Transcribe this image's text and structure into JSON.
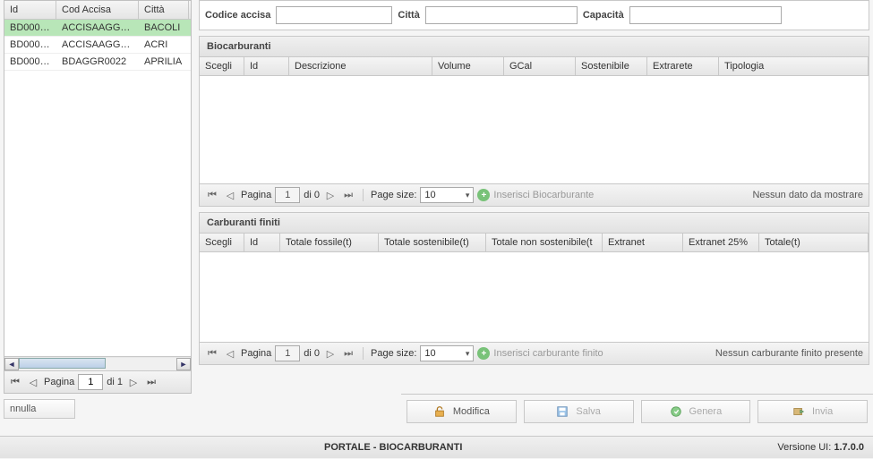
{
  "leftGrid": {
    "headers": {
      "id": "Id",
      "cod": "Cod Accisa",
      "citta": "Città"
    },
    "rows": [
      {
        "id": "BD0001...",
        "cod": "ACCISAAGGR...",
        "citta": "BACOLI"
      },
      {
        "id": "BD0001...",
        "cod": "ACCISAAGGR...",
        "citta": "ACRI"
      },
      {
        "id": "BD0001...",
        "cod": "BDAGGR0022",
        "citta": "APRILIA"
      }
    ],
    "pager": {
      "label": "Pagina",
      "page": "1",
      "of": "di 1"
    }
  },
  "form": {
    "codiceLabel": "Codice accisa",
    "cittaLabel": "Città",
    "capacitaLabel": "Capacità"
  },
  "bio": {
    "title": "Biocarburanti",
    "headers": {
      "scegli": "Scegli",
      "id": "Id",
      "desc": "Descrizione",
      "volume": "Volume",
      "gcal": "GCal",
      "sost": "Sostenibile",
      "extra": "Extrarete",
      "tipo": "Tipologia"
    },
    "pager": {
      "label": "Pagina",
      "page": "1",
      "of": "di 0",
      "pageSizeLabel": "Page size:",
      "pageSize": "10"
    },
    "action": "Inserisci Biocarburante",
    "empty": "Nessun dato da mostrare"
  },
  "carb": {
    "title": "Carburanti finiti",
    "headers": {
      "scegli": "Scegli",
      "id": "Id",
      "fossile": "Totale fossile(t)",
      "sost": "Totale sostenibile(t)",
      "nonsost": "Totale non sostenibile(t",
      "extranet": "Extranet",
      "extranet25": "Extranet 25%",
      "totale": "Totale(t)"
    },
    "pager": {
      "label": "Pagina",
      "page": "1",
      "of": "di 0",
      "pageSizeLabel": "Page size:",
      "pageSize": "10"
    },
    "action": "Inserisci carburante finito",
    "empty": "Nessun carburante finito presente"
  },
  "toolbar": {
    "annulla": "nnulla",
    "modifica": "Modifica",
    "salva": "Salva",
    "genera": "Genera",
    "invia": "Invia"
  },
  "footer": {
    "title": "PORTALE - BIOCARBURANTI",
    "versionLabel": "Versione UI:",
    "version": "1.7.0.0"
  }
}
